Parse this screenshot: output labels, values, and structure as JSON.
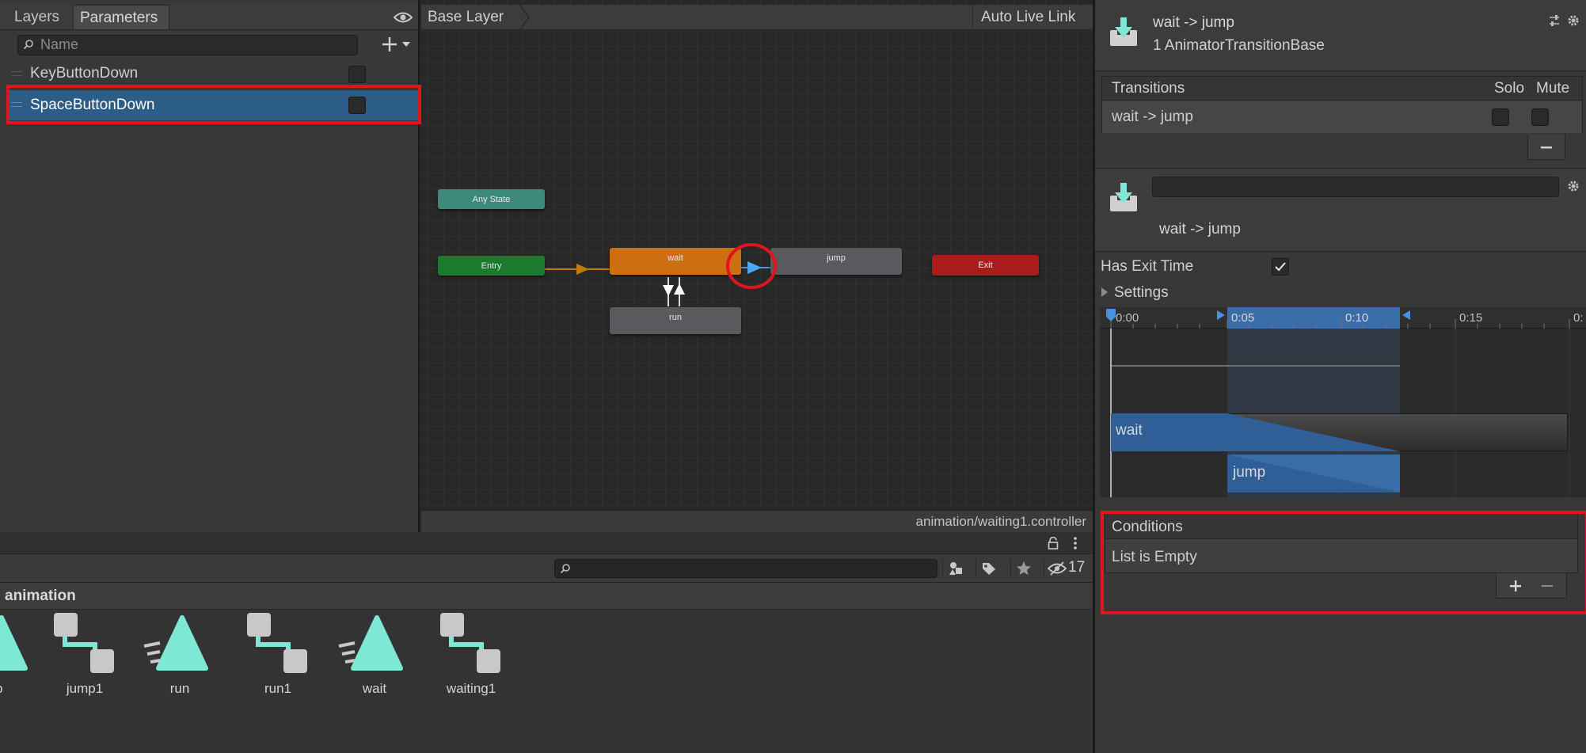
{
  "left_panel": {
    "tabs": [
      "Layers",
      "Parameters"
    ],
    "search_placeholder": "Name",
    "params": [
      {
        "name": "KeyButtonDown",
        "checked": false,
        "selected": false
      },
      {
        "name": "SpaceButtonDown",
        "checked": false,
        "selected": true
      }
    ]
  },
  "graph": {
    "breadcrumb": "Base Layer",
    "auto_live_link": "Auto Live Link",
    "footer_path": "animation/waiting1.controller",
    "nodes": {
      "any_state": "Any State",
      "entry": "Entry",
      "wait": "wait",
      "jump": "jump",
      "exit": "Exit",
      "run": "run"
    }
  },
  "project": {
    "folder": "animation",
    "hidden_count": "17",
    "assets": [
      {
        "name": "jump1",
        "icon": "animator-controller-icon"
      },
      {
        "name": "run",
        "icon": "animation-clip-icon"
      },
      {
        "name": "run1",
        "icon": "animator-controller-icon"
      },
      {
        "name": "wait",
        "icon": "animation-clip-icon"
      },
      {
        "name": "waiting1",
        "icon": "animator-controller-icon"
      }
    ],
    "partial_asset_label": "p"
  },
  "inspector": {
    "header_title": "wait -> jump",
    "header_subtitle": "1 AnimatorTransitionBase",
    "transitions_header": "Transitions",
    "solo_label": "Solo",
    "mute_label": "Mute",
    "transition_row": "wait -> jump",
    "transition_name": "wait -> jump",
    "has_exit_time_label": "Has Exit Time",
    "has_exit_time": true,
    "settings_label": "Settings",
    "timeline": {
      "ticks": [
        "0:00",
        "0:05",
        "0:10",
        "0:15",
        "0:"
      ],
      "clip_from": "wait",
      "clip_to": "jump"
    },
    "conditions_header": "Conditions",
    "conditions_empty": "List is Empty"
  },
  "colors": {
    "selection": "#2c5d87",
    "wait_node": "#cc6f12",
    "entry_node": "#1b7a2e",
    "exit_node": "#a81c1c",
    "any_state_node": "#3e8a7a",
    "asset_icon": "#7ee8d6",
    "highlight": "#e0141c"
  }
}
